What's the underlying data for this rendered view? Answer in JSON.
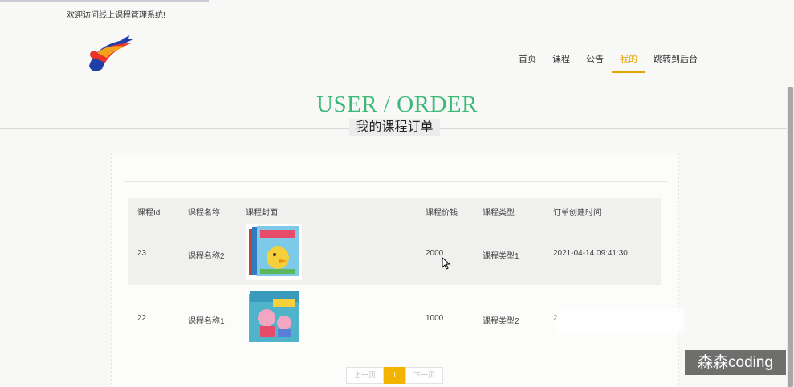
{
  "top_bar": {
    "welcome": "欢迎访问线上课程管理系统!"
  },
  "nav": {
    "items": [
      {
        "label": "首页",
        "active": false
      },
      {
        "label": "课程",
        "active": false
      },
      {
        "label": "公告",
        "active": false
      },
      {
        "label": "我的",
        "active": true
      },
      {
        "label": "跳转到后台",
        "active": false
      }
    ]
  },
  "hero": {
    "title": "USER / ORDER",
    "subtitle": "我的课程订单"
  },
  "table": {
    "headers": [
      "课程Id",
      "课程名称",
      "课程封面",
      "课程价钱",
      "课程类型",
      "订单创建时间"
    ],
    "rows": [
      {
        "id": "23",
        "name": "课程名称2",
        "cover": "book-cover-icon",
        "price": "2000",
        "type": "课程类型1",
        "time": "2021-04-14 09:41:30"
      },
      {
        "id": "22",
        "name": "课程名称1",
        "cover": "book-cover-icon",
        "price": "1000",
        "type": "课程类型2",
        "time": "2"
      }
    ]
  },
  "pagination": {
    "prev": "上一页",
    "current": "1",
    "next": "下一页"
  },
  "watermark": "森森coding",
  "colors": {
    "accent_green": "#3cb878",
    "accent_yellow": "#f2b400"
  }
}
